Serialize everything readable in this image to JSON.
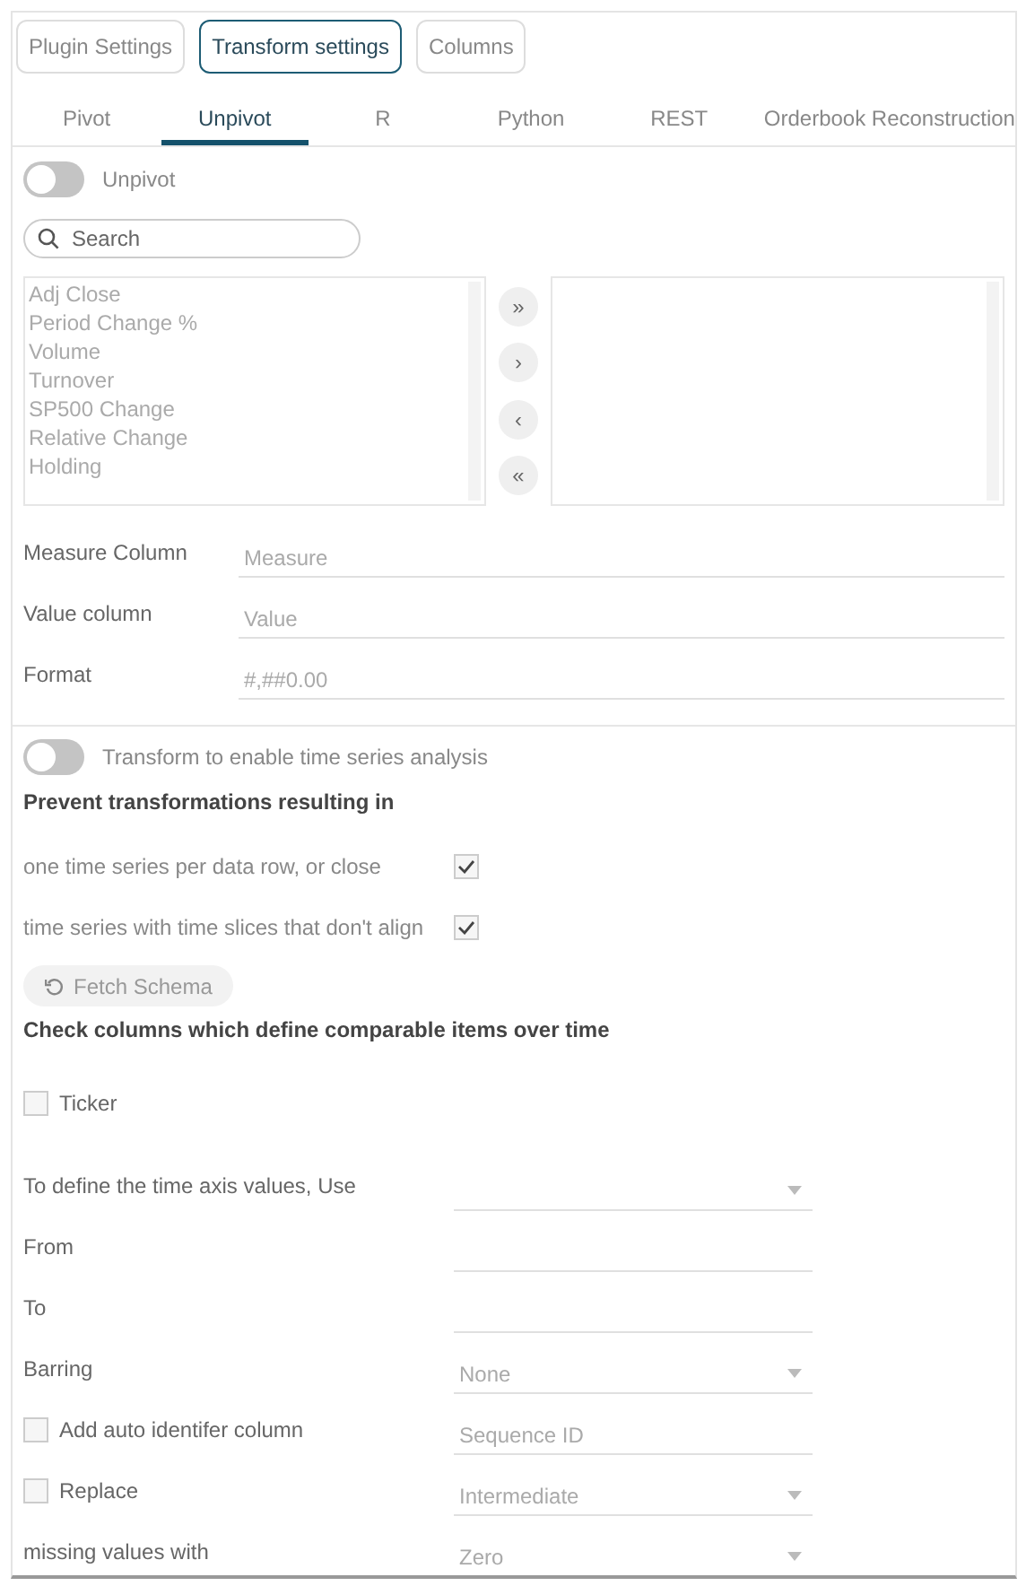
{
  "top_buttons": [
    {
      "label": "Plugin Settings",
      "selected": false
    },
    {
      "label": "Transform settings",
      "selected": true
    },
    {
      "label": "Columns",
      "selected": false
    }
  ],
  "tabs": [
    {
      "label": "Pivot",
      "selected": false
    },
    {
      "label": "Unpivot",
      "selected": true
    },
    {
      "label": "R",
      "selected": false
    },
    {
      "label": "Python",
      "selected": false
    },
    {
      "label": "REST",
      "selected": false
    },
    {
      "label": "Orderbook Reconstruction",
      "selected": false
    }
  ],
  "unpivot_toggle": {
    "label": "Unpivot",
    "on": false
  },
  "search": {
    "placeholder": "Search"
  },
  "available_columns": [
    "Adj Close",
    "Period Change %",
    "Volume",
    "Turnover",
    "SP500 Change",
    "Relative Change",
    "Holding"
  ],
  "move_buttons": [
    "»",
    "›",
    "‹",
    "«"
  ],
  "fields": [
    {
      "label": "Measure Column",
      "placeholder": "Measure"
    },
    {
      "label": "Value column",
      "placeholder": "Value"
    },
    {
      "label": "Format",
      "placeholder": "#,##0.00"
    }
  ],
  "time_series_toggle": {
    "label": "Transform to enable time series analysis",
    "on": false
  },
  "prevent_heading": "Prevent transformations resulting in",
  "prevent_options": [
    {
      "label": "one time series per data row, or close",
      "checked": true
    },
    {
      "label": "time series with time slices that don't align",
      "checked": true
    }
  ],
  "fetch_button": {
    "label": "Fetch Schema",
    "disabled": true
  },
  "check_heading": "Check columns which define comparable items over time",
  "comparable_columns": [
    {
      "label": "Ticker",
      "checked": false
    }
  ],
  "time_settings": [
    {
      "kind": "dropdown",
      "label": "To define the time axis values, Use"
    },
    {
      "kind": "input",
      "label": "From"
    },
    {
      "kind": "input",
      "label": "To"
    },
    {
      "kind": "dropdown",
      "label": "Barring",
      "placeholder": "None"
    },
    {
      "kind": "check_input",
      "label": "Add auto identifer column",
      "checked": false,
      "placeholder": "Sequence ID"
    },
    {
      "kind": "check_dropdown",
      "label": "Replace",
      "checked": false,
      "placeholder": "Intermediate"
    },
    {
      "kind": "dropdown",
      "label": "missing values with",
      "placeholder": "Zero"
    }
  ]
}
